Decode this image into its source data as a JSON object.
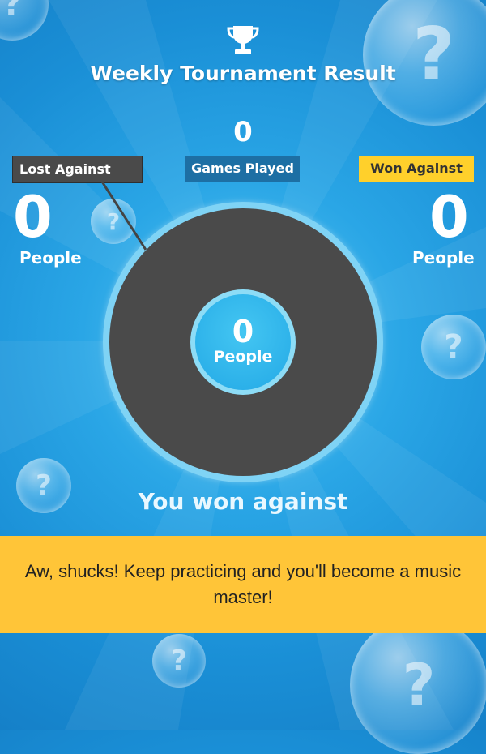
{
  "header": {
    "title": "Weekly Tournament Result",
    "trophy_icon": "trophy-icon"
  },
  "games_played": {
    "label": "Games Played",
    "value": "0"
  },
  "lost_against": {
    "label": "Lost Against",
    "value": "0",
    "unit": "People"
  },
  "won_against": {
    "label": "Won Against",
    "value": "0",
    "unit": "People"
  },
  "center": {
    "value": "0",
    "unit": "People"
  },
  "summary": "You won against",
  "banner": {
    "message": "Aw, shucks! Keep practicing and you'll become a music master!"
  },
  "colors": {
    "background": "#2aa6e6",
    "lost_tag": "#4a4a4a",
    "games_tag": "#1d6fa4",
    "won_tag": "#ffd02b",
    "banner": "#ffc538"
  }
}
